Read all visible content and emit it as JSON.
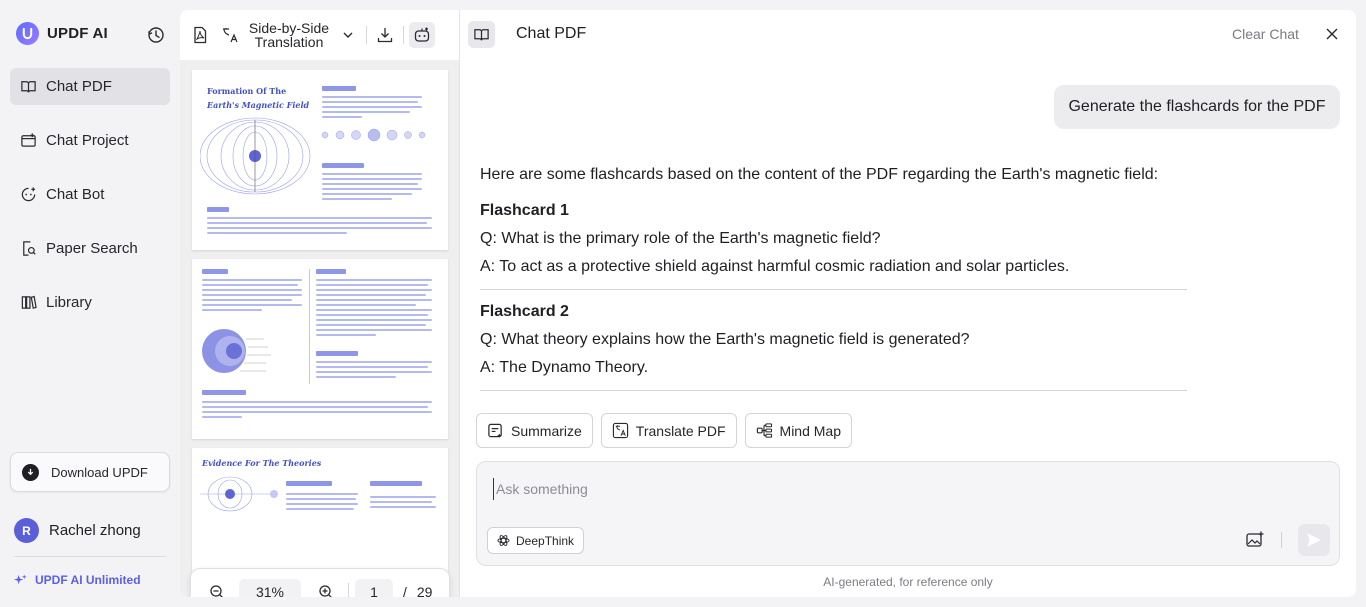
{
  "sidebar": {
    "brand": "UPDF AI",
    "nav": [
      {
        "label": "Chat PDF",
        "icon": "book-open-icon",
        "active": true
      },
      {
        "label": "Chat Project",
        "icon": "folder-plus-icon"
      },
      {
        "label": "Chat Bot",
        "icon": "chat-bot-icon"
      },
      {
        "label": "Paper Search",
        "icon": "paper-search-icon"
      },
      {
        "label": "Library",
        "icon": "library-icon"
      }
    ],
    "download_label": "Download UPDF",
    "user": {
      "initial": "R",
      "name": "Rachel zhong"
    },
    "plan_label": "UPDF AI Unlimited"
  },
  "pdf": {
    "translate_label": "Side-by-Side Translation",
    "zoom": "31%",
    "page_current": "1",
    "page_sep": "/",
    "page_total": "29",
    "pages": [
      {
        "title_line1": "Formation Of The",
        "title_line2": "Earth's Magnetic Field"
      },
      {
        "title_line1": ""
      },
      {
        "title_line1": "Evidence For The Theories"
      }
    ]
  },
  "chat": {
    "title": "Chat PDF",
    "clear_label": "Clear Chat",
    "user_message": "Generate the flashcards for the PDF",
    "answer_intro": "Here are some flashcards based on the content of the PDF regarding the Earth's magnetic field:",
    "flashcards": [
      {
        "heading": "Flashcard 1",
        "q": "Q: What is the primary role of the Earth's magnetic field?",
        "a": "A: To act as a protective shield against harmful cosmic radiation and solar particles."
      },
      {
        "heading": "Flashcard 2",
        "q": "Q: What theory explains how the Earth's magnetic field is generated?",
        "a": "A: The Dynamo Theory."
      }
    ],
    "actions": [
      "Summarize",
      "Translate PDF",
      "Mind Map"
    ],
    "input_placeholder": "Ask something",
    "deepthink_label": "DeepThink",
    "disclaimer": "AI-generated, for reference only"
  },
  "colors": {
    "accent": "#5b5fe6",
    "pdf_blue": "#4450c8"
  }
}
